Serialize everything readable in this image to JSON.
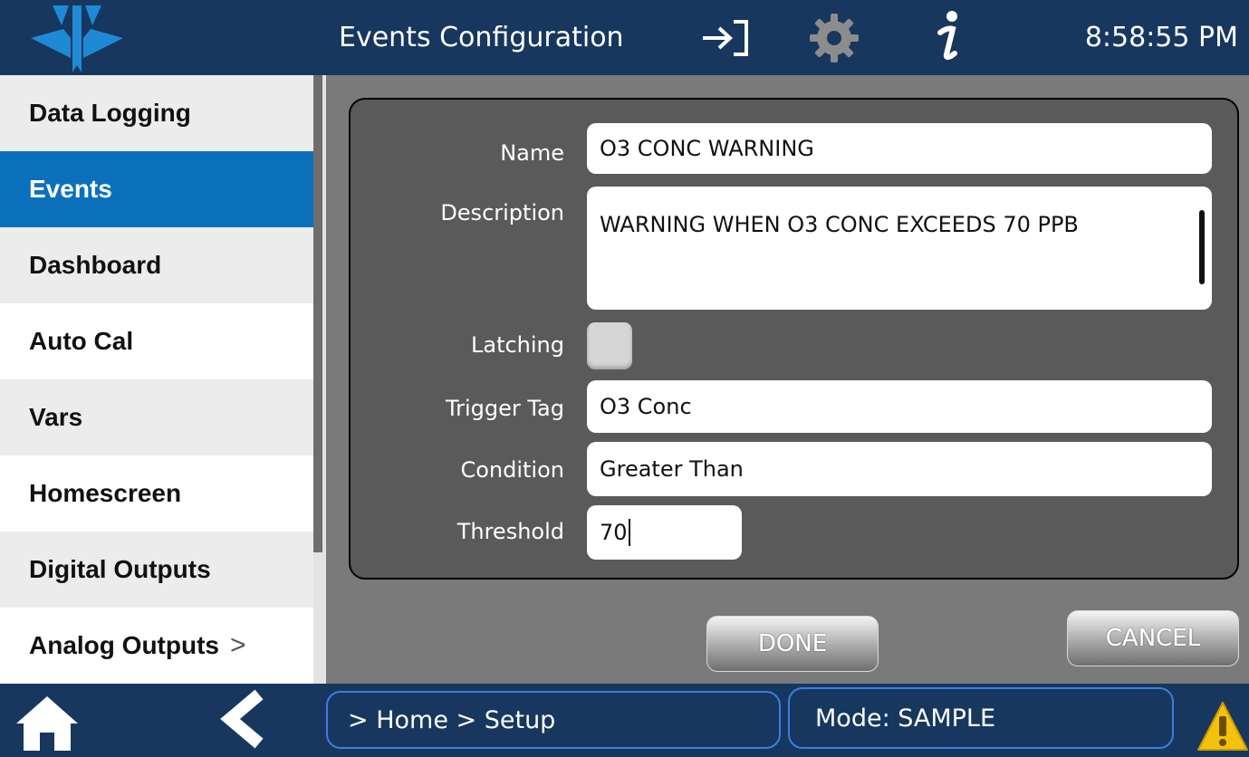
{
  "header": {
    "title": "Events Configuration",
    "time": "8:58:55 PM"
  },
  "icons": {
    "logo": "teledyne-logo",
    "login": "sign-in-icon",
    "settings": "gear-icon",
    "info": "info-icon",
    "home": "home-icon",
    "back": "chevron-left-icon",
    "warning": "warning-icon",
    "submenu": "chevron-right-icon"
  },
  "sidebar": {
    "items": [
      {
        "label": "Data Logging",
        "active": false
      },
      {
        "label": "Events",
        "active": true
      },
      {
        "label": "Dashboard",
        "active": false
      },
      {
        "label": "Auto Cal",
        "active": false
      },
      {
        "label": "Vars",
        "active": false
      },
      {
        "label": "Homescreen",
        "active": false
      },
      {
        "label": "Digital Outputs",
        "active": false
      },
      {
        "label": "Analog Outputs",
        "active": false,
        "chevron": ">"
      }
    ]
  },
  "form": {
    "name_label": "Name",
    "name_value": "O3 CONC WARNING",
    "description_label": "Description",
    "description_value": "WARNING WHEN O3 CONC EXCEEDS 70 PPB",
    "latching_label": "Latching",
    "latching_checked": false,
    "trigger_tag_label": "Trigger Tag",
    "trigger_tag_value": "O3 Conc",
    "condition_label": "Condition",
    "condition_value": "Greater Than",
    "threshold_label": "Threshold",
    "threshold_value": "70"
  },
  "buttons": {
    "done": "DONE",
    "cancel": "CANCEL"
  },
  "footer": {
    "breadcrumb": "> Home > Setup",
    "mode": "Mode: SAMPLE"
  },
  "colors": {
    "header_bg": "#17375e",
    "active_item": "#0b70bc",
    "panel_bg": "#5a5a5a",
    "content_bg": "#7a7a7a",
    "warning": "#f4c20d"
  }
}
